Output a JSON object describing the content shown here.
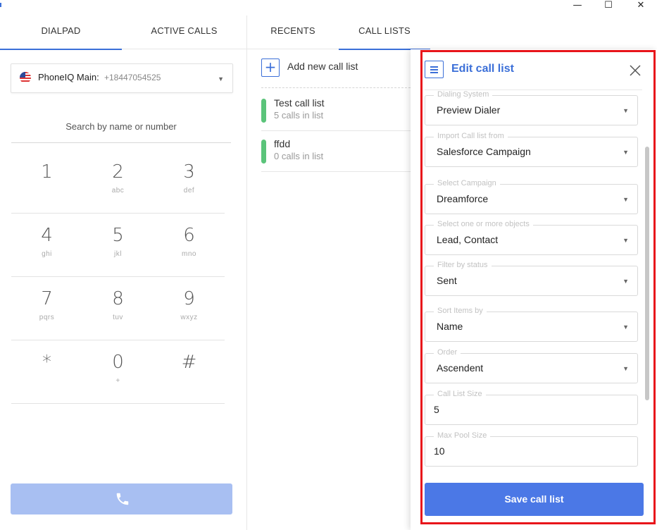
{
  "window": {
    "minimize_glyph": "—",
    "maximize_glyph": "☐",
    "close_glyph": "✕"
  },
  "left_tabs": [
    {
      "label": "DIALPAD",
      "active": true
    },
    {
      "label": "ACTIVE CALLS",
      "active": false
    }
  ],
  "mid_tabs": [
    {
      "label": "RECENTS",
      "active": false
    },
    {
      "label": "CALL LISTS",
      "active": true
    }
  ],
  "line_select": {
    "flag_icon": "us-flag-icon",
    "name": "PhoneIQ Main:",
    "number": "+18447054525"
  },
  "search": {
    "placeholder": "Search by name or number"
  },
  "keypad": [
    [
      {
        "digit": "1",
        "letters": ""
      },
      {
        "digit": "2",
        "letters": "abc"
      },
      {
        "digit": "3",
        "letters": "def"
      }
    ],
    [
      {
        "digit": "4",
        "letters": "ghi"
      },
      {
        "digit": "5",
        "letters": "jkl"
      },
      {
        "digit": "6",
        "letters": "mno"
      }
    ],
    [
      {
        "digit": "7",
        "letters": "pqrs"
      },
      {
        "digit": "8",
        "letters": "tuv"
      },
      {
        "digit": "9",
        "letters": "wxyz"
      }
    ],
    [
      {
        "digit": "*",
        "letters": ""
      },
      {
        "digit": "0",
        "letters": "+"
      },
      {
        "digit": "#",
        "letters": ""
      }
    ]
  ],
  "call_button": {
    "icon": "phone-icon",
    "color": "#a8bff2"
  },
  "call_lists": {
    "add_label": "Add new call list",
    "items": [
      {
        "name": "Test call list",
        "count": "5 calls in list",
        "status_color": "#5bc47a"
      },
      {
        "name": "ffdd",
        "count": "0 calls in list",
        "status_color": "#5bc47a"
      }
    ]
  },
  "edit_panel": {
    "title": "Edit call list",
    "fields": [
      {
        "label": "Dialing System",
        "value": "Preview Dialer",
        "type": "select"
      },
      {
        "label": "Import Call list from",
        "value": "Salesforce Campaign",
        "type": "select"
      },
      {
        "label": "Select Campaign",
        "value": "Dreamforce",
        "type": "select"
      },
      {
        "label": "Select one or more objects",
        "value": "Lead, Contact",
        "type": "select"
      },
      {
        "label": "Filter by status",
        "value": "Sent",
        "type": "select"
      },
      {
        "label": "Sort Items by",
        "value": "Name",
        "type": "select"
      },
      {
        "label": "Order",
        "value": "Ascendent",
        "type": "select"
      },
      {
        "label": "Call List Size",
        "value": "5",
        "type": "input"
      },
      {
        "label": "Max Pool Size",
        "value": "10",
        "type": "input"
      }
    ],
    "save_label": "Save call list"
  },
  "colors": {
    "accent": "#3b6fd8",
    "save_button": "#4b78e6",
    "highlight_frame": "#e8151b"
  }
}
